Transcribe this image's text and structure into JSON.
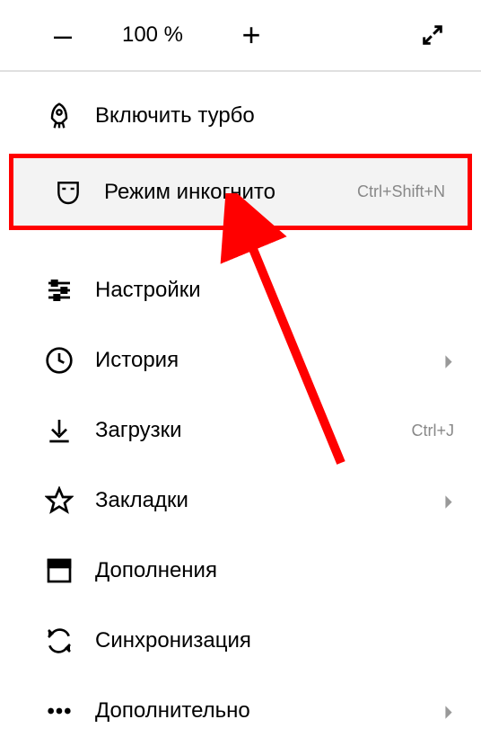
{
  "zoom": {
    "minus": "–",
    "value": "100 %",
    "plus": "+"
  },
  "menu": {
    "turbo": "Включить турбо",
    "incognito": {
      "label": "Режим инкогнито",
      "shortcut": "Ctrl+Shift+N"
    },
    "settings": "Настройки",
    "history": "История",
    "downloads": {
      "label": "Загрузки",
      "shortcut": "Ctrl+J"
    },
    "bookmarks": "Закладки",
    "addons": "Дополнения",
    "sync": "Синхронизация",
    "more": "Дополнительно"
  }
}
